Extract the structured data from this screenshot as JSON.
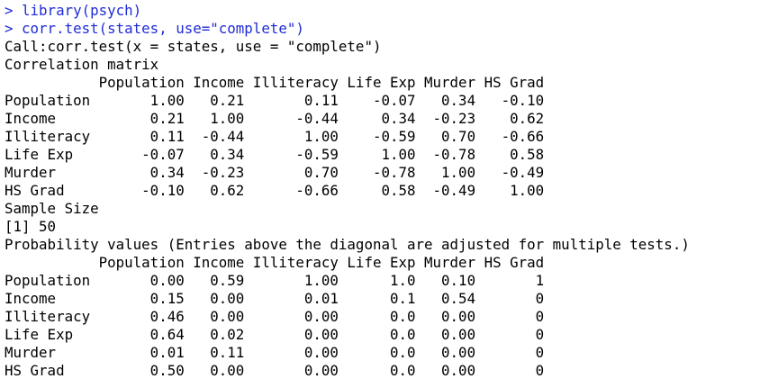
{
  "console": {
    "colors": {
      "command": "#1f2bd6",
      "output": "#000000",
      "background": "#ffffff"
    },
    "lines": [
      {
        "type": "cmd",
        "text": "> library(psych)"
      },
      {
        "type": "cmd",
        "text": "> corr.test(states, use=\"complete\")"
      },
      {
        "type": "out",
        "text": "Call:corr.test(x = states, use = \"complete\")"
      },
      {
        "type": "out",
        "text": "Correlation matrix"
      },
      {
        "type": "out",
        "text": "           Population Income Illiteracy Life Exp Murder HS Grad"
      },
      {
        "type": "out",
        "text": "Population       1.00   0.21       0.11    -0.07   0.34   -0.10"
      },
      {
        "type": "out",
        "text": "Income           0.21   1.00      -0.44     0.34  -0.23    0.62"
      },
      {
        "type": "out",
        "text": "Illiteracy       0.11  -0.44       1.00    -0.59   0.70   -0.66"
      },
      {
        "type": "out",
        "text": "Life Exp        -0.07   0.34      -0.59     1.00  -0.78    0.58"
      },
      {
        "type": "out",
        "text": "Murder           0.34  -0.23       0.70    -0.78   1.00   -0.49"
      },
      {
        "type": "out",
        "text": "HS Grad         -0.10   0.62      -0.66     0.58  -0.49    1.00"
      },
      {
        "type": "out",
        "text": "Sample Size"
      },
      {
        "type": "out",
        "text": "[1] 50"
      },
      {
        "type": "out",
        "text": "Probability values (Entries above the diagonal are adjusted for multiple tests.)"
      },
      {
        "type": "out",
        "text": "           Population Income Illiteracy Life Exp Murder HS Grad"
      },
      {
        "type": "out",
        "text": "Population       0.00   0.59       1.00      1.0   0.10       1"
      },
      {
        "type": "out",
        "text": "Income           0.15   0.00       0.01      0.1   0.54       0"
      },
      {
        "type": "out",
        "text": "Illiteracy       0.46   0.00       0.00      0.0   0.00       0"
      },
      {
        "type": "out",
        "text": "Life Exp         0.64   0.02       0.00      0.0   0.00       0"
      },
      {
        "type": "out",
        "text": "Murder           0.01   0.11       0.00      0.0   0.00       0"
      },
      {
        "type": "out",
        "text": "HS Grad          0.50   0.00       0.00      0.0   0.00       0"
      }
    ]
  }
}
